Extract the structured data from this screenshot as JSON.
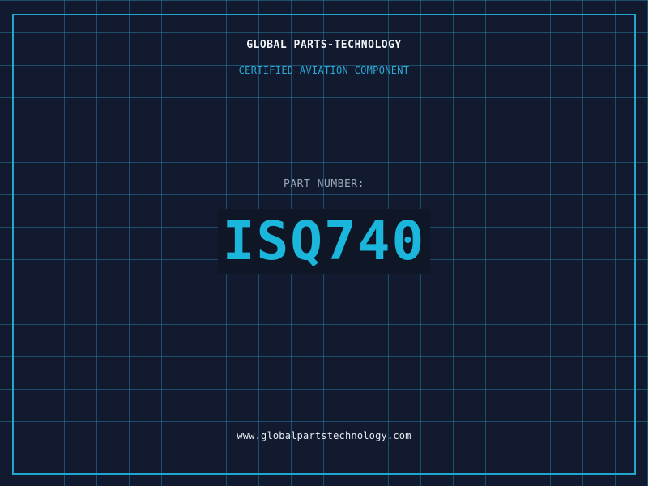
{
  "card": {
    "company_name": "GLOBAL PARTS-TECHNOLOGY",
    "subtitle": "CERTIFIED AVIATION COMPONENT",
    "part_label": "PART NUMBER:",
    "part_number": "ISQ740",
    "website": "www.globalpartstechnology.com"
  },
  "colors": {
    "background": "#111a2e",
    "grid": "#26789f",
    "frame": "#1fa7d0",
    "accent": "#1ab6db",
    "label": "#9aa7b8",
    "text": "#f1f4f8"
  }
}
